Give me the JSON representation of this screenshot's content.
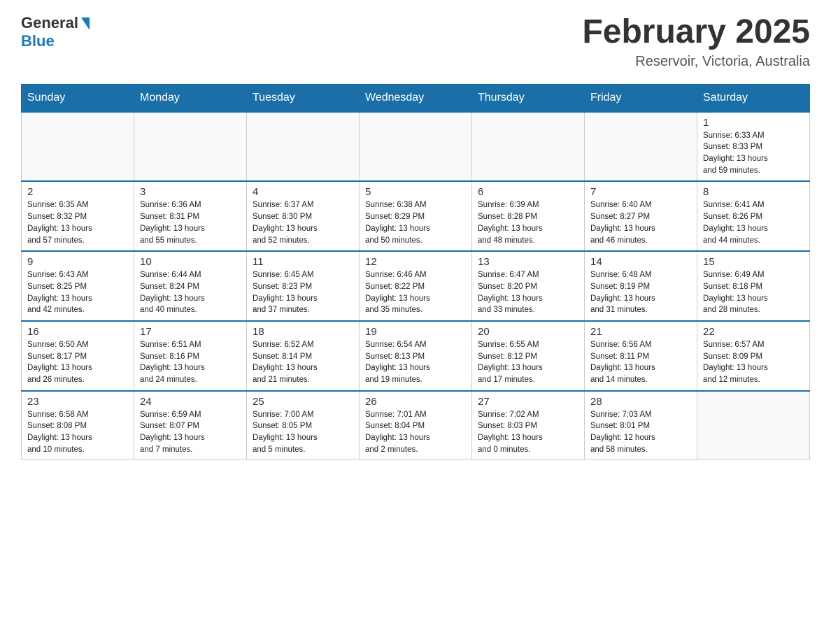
{
  "logo": {
    "general": "General",
    "blue": "Blue"
  },
  "title": {
    "month": "February 2025",
    "location": "Reservoir, Victoria, Australia"
  },
  "weekdays": [
    "Sunday",
    "Monday",
    "Tuesday",
    "Wednesday",
    "Thursday",
    "Friday",
    "Saturday"
  ],
  "weeks": [
    [
      {
        "day": "",
        "info": ""
      },
      {
        "day": "",
        "info": ""
      },
      {
        "day": "",
        "info": ""
      },
      {
        "day": "",
        "info": ""
      },
      {
        "day": "",
        "info": ""
      },
      {
        "day": "",
        "info": ""
      },
      {
        "day": "1",
        "info": "Sunrise: 6:33 AM\nSunset: 8:33 PM\nDaylight: 13 hours\nand 59 minutes."
      }
    ],
    [
      {
        "day": "2",
        "info": "Sunrise: 6:35 AM\nSunset: 8:32 PM\nDaylight: 13 hours\nand 57 minutes."
      },
      {
        "day": "3",
        "info": "Sunrise: 6:36 AM\nSunset: 8:31 PM\nDaylight: 13 hours\nand 55 minutes."
      },
      {
        "day": "4",
        "info": "Sunrise: 6:37 AM\nSunset: 8:30 PM\nDaylight: 13 hours\nand 52 minutes."
      },
      {
        "day": "5",
        "info": "Sunrise: 6:38 AM\nSunset: 8:29 PM\nDaylight: 13 hours\nand 50 minutes."
      },
      {
        "day": "6",
        "info": "Sunrise: 6:39 AM\nSunset: 8:28 PM\nDaylight: 13 hours\nand 48 minutes."
      },
      {
        "day": "7",
        "info": "Sunrise: 6:40 AM\nSunset: 8:27 PM\nDaylight: 13 hours\nand 46 minutes."
      },
      {
        "day": "8",
        "info": "Sunrise: 6:41 AM\nSunset: 8:26 PM\nDaylight: 13 hours\nand 44 minutes."
      }
    ],
    [
      {
        "day": "9",
        "info": "Sunrise: 6:43 AM\nSunset: 8:25 PM\nDaylight: 13 hours\nand 42 minutes."
      },
      {
        "day": "10",
        "info": "Sunrise: 6:44 AM\nSunset: 8:24 PM\nDaylight: 13 hours\nand 40 minutes."
      },
      {
        "day": "11",
        "info": "Sunrise: 6:45 AM\nSunset: 8:23 PM\nDaylight: 13 hours\nand 37 minutes."
      },
      {
        "day": "12",
        "info": "Sunrise: 6:46 AM\nSunset: 8:22 PM\nDaylight: 13 hours\nand 35 minutes."
      },
      {
        "day": "13",
        "info": "Sunrise: 6:47 AM\nSunset: 8:20 PM\nDaylight: 13 hours\nand 33 minutes."
      },
      {
        "day": "14",
        "info": "Sunrise: 6:48 AM\nSunset: 8:19 PM\nDaylight: 13 hours\nand 31 minutes."
      },
      {
        "day": "15",
        "info": "Sunrise: 6:49 AM\nSunset: 8:18 PM\nDaylight: 13 hours\nand 28 minutes."
      }
    ],
    [
      {
        "day": "16",
        "info": "Sunrise: 6:50 AM\nSunset: 8:17 PM\nDaylight: 13 hours\nand 26 minutes."
      },
      {
        "day": "17",
        "info": "Sunrise: 6:51 AM\nSunset: 8:16 PM\nDaylight: 13 hours\nand 24 minutes."
      },
      {
        "day": "18",
        "info": "Sunrise: 6:52 AM\nSunset: 8:14 PM\nDaylight: 13 hours\nand 21 minutes."
      },
      {
        "day": "19",
        "info": "Sunrise: 6:54 AM\nSunset: 8:13 PM\nDaylight: 13 hours\nand 19 minutes."
      },
      {
        "day": "20",
        "info": "Sunrise: 6:55 AM\nSunset: 8:12 PM\nDaylight: 13 hours\nand 17 minutes."
      },
      {
        "day": "21",
        "info": "Sunrise: 6:56 AM\nSunset: 8:11 PM\nDaylight: 13 hours\nand 14 minutes."
      },
      {
        "day": "22",
        "info": "Sunrise: 6:57 AM\nSunset: 8:09 PM\nDaylight: 13 hours\nand 12 minutes."
      }
    ],
    [
      {
        "day": "23",
        "info": "Sunrise: 6:58 AM\nSunset: 8:08 PM\nDaylight: 13 hours\nand 10 minutes."
      },
      {
        "day": "24",
        "info": "Sunrise: 6:59 AM\nSunset: 8:07 PM\nDaylight: 13 hours\nand 7 minutes."
      },
      {
        "day": "25",
        "info": "Sunrise: 7:00 AM\nSunset: 8:05 PM\nDaylight: 13 hours\nand 5 minutes."
      },
      {
        "day": "26",
        "info": "Sunrise: 7:01 AM\nSunset: 8:04 PM\nDaylight: 13 hours\nand 2 minutes."
      },
      {
        "day": "27",
        "info": "Sunrise: 7:02 AM\nSunset: 8:03 PM\nDaylight: 13 hours\nand 0 minutes."
      },
      {
        "day": "28",
        "info": "Sunrise: 7:03 AM\nSunset: 8:01 PM\nDaylight: 12 hours\nand 58 minutes."
      },
      {
        "day": "",
        "info": ""
      }
    ]
  ]
}
